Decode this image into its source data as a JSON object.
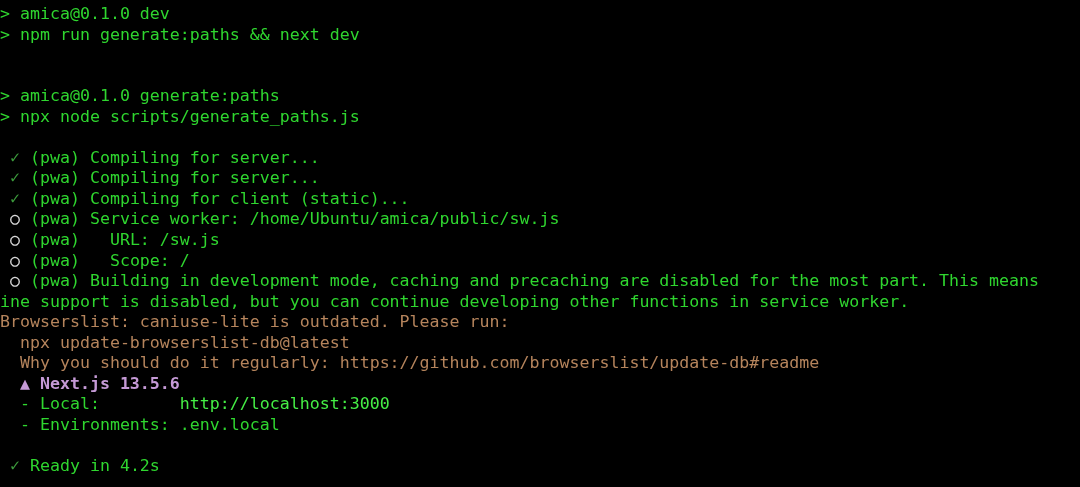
{
  "terminal": {
    "lines": [
      {
        "kind": "text",
        "segments": [
          {
            "text": "> amica@0.1.0 dev",
            "color": "#2fd62f"
          }
        ]
      },
      {
        "kind": "text",
        "segments": [
          {
            "text": "> npm run generate:paths && next dev",
            "color": "#2fd62f"
          }
        ]
      },
      {
        "kind": "blank"
      },
      {
        "kind": "blank"
      },
      {
        "kind": "text",
        "segments": [
          {
            "text": "> amica@0.1.0 generate:paths",
            "color": "#2fd62f"
          }
        ]
      },
      {
        "kind": "text",
        "segments": [
          {
            "text": "> npx node scripts/generate_paths.js",
            "color": "#2fd62f"
          }
        ]
      },
      {
        "kind": "blank"
      },
      {
        "kind": "text",
        "segments": [
          {
            "text": " ✓",
            "color": "#3c9a3c"
          },
          {
            "text": " (pwa) Compiling for server...",
            "color": "#2fd62f"
          }
        ]
      },
      {
        "kind": "text",
        "segments": [
          {
            "text": " ✓",
            "color": "#3c9a3c"
          },
          {
            "text": " (pwa) Compiling for server...",
            "color": "#2fd62f"
          }
        ]
      },
      {
        "kind": "text",
        "segments": [
          {
            "text": " ✓",
            "color": "#3c9a3c"
          },
          {
            "text": " (pwa) Compiling for client (static)...",
            "color": "#2fd62f"
          }
        ]
      },
      {
        "kind": "text",
        "segments": [
          {
            "text": " ○",
            "color": "#d8d8d8",
            "bold": true
          },
          {
            "text": " (pwa) Service worker: /home/Ubuntu/amica/public/sw.js",
            "color": "#2fd62f"
          }
        ]
      },
      {
        "kind": "text",
        "segments": [
          {
            "text": " ○",
            "color": "#d8d8d8",
            "bold": true
          },
          {
            "text": " (pwa)   URL: /sw.js",
            "color": "#2fd62f"
          }
        ]
      },
      {
        "kind": "text",
        "segments": [
          {
            "text": " ○",
            "color": "#d8d8d8",
            "bold": true
          },
          {
            "text": " (pwa)   Scope: /",
            "color": "#2fd62f"
          }
        ]
      },
      {
        "kind": "text",
        "segments": [
          {
            "text": " ○",
            "color": "#d8d8d8",
            "bold": true
          },
          {
            "text": " (pwa) Building in development mode, caching and precaching are disabled for the most part. This means",
            "color": "#2fd62f"
          }
        ]
      },
      {
        "kind": "text",
        "segments": [
          {
            "text": "ine support is disabled, but you can continue developing other functions in service worker.",
            "color": "#2fd62f"
          }
        ]
      },
      {
        "kind": "text",
        "segments": [
          {
            "text": "Browserslist: caniuse-lite is outdated. Please run:",
            "color": "#b5845c"
          }
        ]
      },
      {
        "kind": "text",
        "segments": [
          {
            "text": "  npx update-browserslist-db@latest",
            "color": "#b5845c"
          }
        ]
      },
      {
        "kind": "text",
        "segments": [
          {
            "text": "  Why you should do it regularly: https://github.com/browserslist/update-db#readme",
            "color": "#b5845c"
          }
        ]
      },
      {
        "kind": "text",
        "segments": [
          {
            "text": "  ▲ Next.js 13.5.6",
            "color": "#c59ad6",
            "bold": true
          }
        ]
      },
      {
        "kind": "text",
        "segments": [
          {
            "text": "  - Local:        ",
            "color": "#2fd62f"
          },
          {
            "text": "http://localhost:3000",
            "color": "#45ee45"
          }
        ]
      },
      {
        "kind": "text",
        "segments": [
          {
            "text": "  - Environments: .env.local",
            "color": "#2fd62f"
          }
        ]
      },
      {
        "kind": "blank"
      },
      {
        "kind": "text",
        "segments": [
          {
            "text": " ✓",
            "color": "#3c9a3c"
          },
          {
            "text": " Ready in 4.2s",
            "color": "#2fd62f"
          }
        ]
      }
    ]
  }
}
